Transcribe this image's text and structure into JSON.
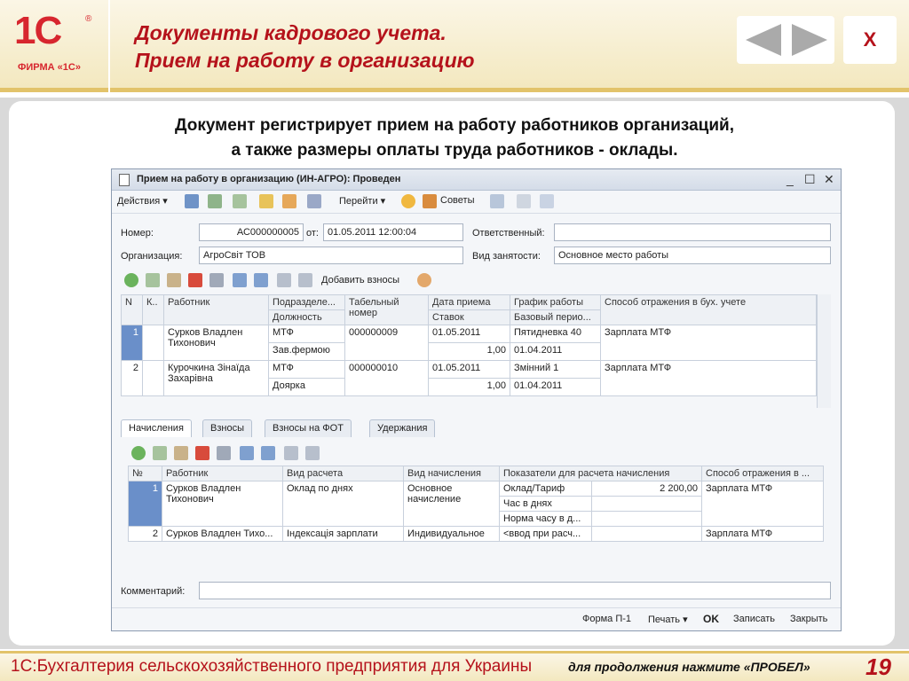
{
  "logo": {
    "text": "1С",
    "sub": "ФИРМА «1С»",
    "reg": "®"
  },
  "slide": {
    "title_line1": "Документы кадрового учета.",
    "title_line2": "Прием на работу в организацию",
    "close": "X",
    "desc_line1": "Документ регистрирует прием на работу работников организаций,",
    "desc_line2": "а также размеры оплаты труда работников - оклады.",
    "footer_left": "1С:Бухгалтерия сельскохозяйственного предприятия для Украины",
    "footer_hint": "для продолжения нажмите «ПРОБЕЛ»",
    "page": "19"
  },
  "window": {
    "title": "Прием на работу в организацию (ИН-АГРО): Проведен",
    "controls": [
      "_",
      "☐",
      "✕"
    ]
  },
  "toolbar": {
    "actions": "Действия ▾",
    "goto": "Перейти ▾",
    "tips": "Советы"
  },
  "form": {
    "number_label": "Номер:",
    "number_value": "АС000000005",
    "from_label": "от:",
    "date_value": "01.05.2011 12:00:04",
    "responsible_label": "Ответственный:",
    "responsible_value": "",
    "org_label": "Организация:",
    "org_value": "АгроСвіт ТОВ",
    "employment_label": "Вид занятости:",
    "employment_value": "Основное место работы",
    "add_contrib": "Добавить взносы",
    "comment_label": "Комментарий:",
    "comment_value": ""
  },
  "table1": {
    "headers_top": [
      "N",
      "К..",
      "Работник",
      "Подразделе...",
      "Табельный номер",
      "Дата приема",
      "График работы",
      "Способ отражения в бух. учете"
    ],
    "headers_bottom": [
      "Должность",
      "Ставок",
      "Базовый перио..."
    ],
    "rows": [
      {
        "n": "1",
        "worker": "Сурков Владлен Тихонович",
        "dept": "МТФ",
        "position": "Зав.фермою",
        "tab_no": "000000009",
        "date": "01.05.2011",
        "rate": "1,00",
        "schedule": "Пятидневка 40",
        "period": "01.04.2011",
        "method": "Зарплата МТФ"
      },
      {
        "n": "2",
        "worker": "Курочкина Зінаїда Захарівна",
        "dept": "МТФ",
        "position": "Доярка",
        "tab_no": "000000010",
        "date": "01.05.2011",
        "rate": "1,00",
        "schedule": "Змінний 1",
        "period": "01.04.2011",
        "method": "Зарплата МТФ"
      }
    ]
  },
  "tabs": [
    "Начисления",
    "Взносы",
    "Взносы на ФОТ",
    "Удержания"
  ],
  "table2": {
    "headers": [
      "№",
      "Работник",
      "Вид расчета",
      "Вид начисления",
      "Показатели для расчета начисления",
      "Способ отражения в ..."
    ],
    "rows": [
      {
        "n": "1",
        "worker": "Сурков Владлен Тихонович",
        "calc": "Оклад по днях",
        "kind": "Основное начисление",
        "ind": [
          "Оклад/Тариф",
          "Час в днях",
          "Норма часу в д..."
        ],
        "val": "2 200,00",
        "method": "Зарплата МТФ"
      },
      {
        "n": "2",
        "worker": "Сурков Владлен Тихо...",
        "calc": "Індексація зарплати",
        "kind": "Индивидуальное",
        "ind": [
          "<ввод при расч..."
        ],
        "val": "",
        "method": "Зарплата МТФ"
      }
    ]
  },
  "footer_buttons": {
    "form": "Форма П-1",
    "print": "Печать ▾",
    "ok": "OK",
    "save": "Записать",
    "close": "Закрыть"
  },
  "colors": {
    "accent": "#b5121b",
    "brand": "#d7262e",
    "selection": "#6a8fc9"
  }
}
